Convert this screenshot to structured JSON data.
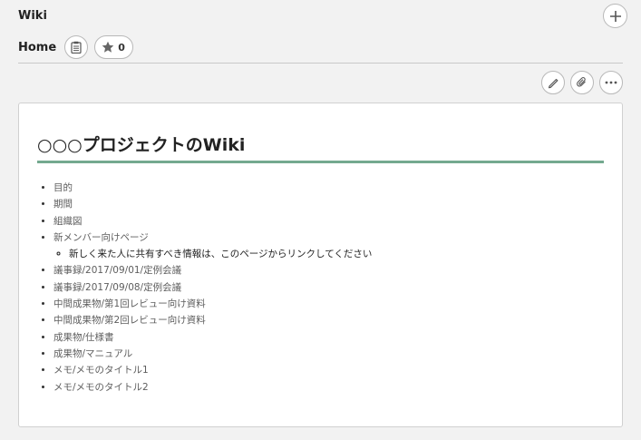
{
  "app": {
    "title": "Wiki"
  },
  "header": {
    "page_title": "Home",
    "star_count": "0"
  },
  "icons": {
    "add": "plus-icon",
    "clipboard": "clipboard-icon",
    "star": "star-icon",
    "edit": "pencil-icon",
    "attach": "paperclip-icon",
    "more": "more-icon"
  },
  "colors": {
    "accent_underline": "#74a98f",
    "background": "#f2f2f2"
  },
  "wiki": {
    "heading": "○○○プロジェクトのWiki",
    "items": [
      {
        "label": "目的"
      },
      {
        "label": "期間"
      },
      {
        "label": "組織図"
      },
      {
        "label": "新メンバー向けページ",
        "sub": "新しく来た人に共有すべき情報は、このページからリンクしてください"
      },
      {
        "label": "議事録/2017/09/01/定例会議"
      },
      {
        "label": "議事録/2017/09/08/定例会議"
      },
      {
        "label": "中間成果物/第1回レビュー向け資料"
      },
      {
        "label": "中間成果物/第2回レビュー向け資料"
      },
      {
        "label": "成果物/仕様書"
      },
      {
        "label": "成果物/マニュアル"
      },
      {
        "label": "メモ/メモのタイトル1"
      },
      {
        "label": "メモ/メモのタイトル2"
      }
    ]
  }
}
